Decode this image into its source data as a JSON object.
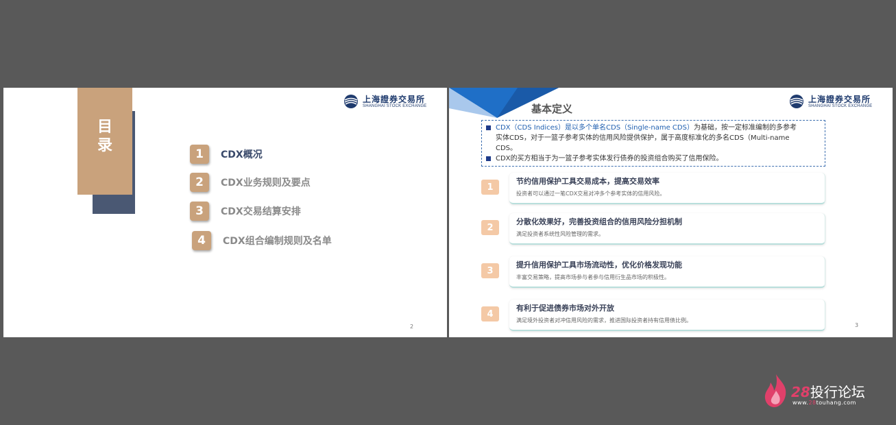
{
  "logo": {
    "cn": "上海證券交易所",
    "en": "SHANGHAI STOCK EXCHANGE"
  },
  "slide_left": {
    "toc_title": "目录",
    "items": [
      {
        "num": "1",
        "label": "CDX概况"
      },
      {
        "num": "2",
        "label": "CDX业务规则及要点"
      },
      {
        "num": "3",
        "label": "CDX交易结算安排"
      },
      {
        "num": "4",
        "label": "CDX组合编制规则及名单"
      }
    ],
    "page_number": "2"
  },
  "slide_right": {
    "title": "基本定义",
    "definition": {
      "p1_pre": "CDX（CDS   Indices）是以",
      "p1_hl": "多个单名CDS（Single-name CDS）",
      "p1_post": "为基础，按一定标准编制的多参考",
      "p1_line2": "实体CDS，对于一篮子参考实体的信用风险提供保护，属于高度标准化的多名CDS（Multi-name",
      "p1_line3": "CDS。",
      "p2": "CDX的买方相当于为一篮子参考实体发行债券的投资组合购买了信用保险。"
    },
    "cards": [
      {
        "num": "1",
        "title": "节约信用保护工具交易成本，提高交易效率",
        "desc": "投资者可以通过一笔CDX交易对冲多个参考实体的信用风险。"
      },
      {
        "num": "2",
        "title": "分散化效果好，完善投资组合的信用风险分担机制",
        "desc": "满足投资者系统性风险管理的需求。"
      },
      {
        "num": "3",
        "title": "提升信用保护工具市场流动性，优化价格发现功能",
        "desc": "丰富交易策略，提高市场参与者参与信用衍生品市场的积极性。"
      },
      {
        "num": "4",
        "title": "有利于促进债券市场对外开放",
        "desc": "满足境外投资者对冲信用风险的需求，推进国际投资者持有信用债比例。"
      }
    ],
    "page_number": "3"
  },
  "watermark": {
    "num": "28",
    "text": "投行论坛",
    "url_pre": "www.",
    "url_num": "28",
    "url_post": "touhang.com"
  },
  "colors": {
    "background": "#595959",
    "toc_accent": "#c9a27c",
    "toc_shadow": "#4a5873",
    "card_number": "#f4c9a6",
    "card_border": "#b9dfdc",
    "corner_blue": "#1f6fc7",
    "definition_border": "#3d6fb0"
  }
}
